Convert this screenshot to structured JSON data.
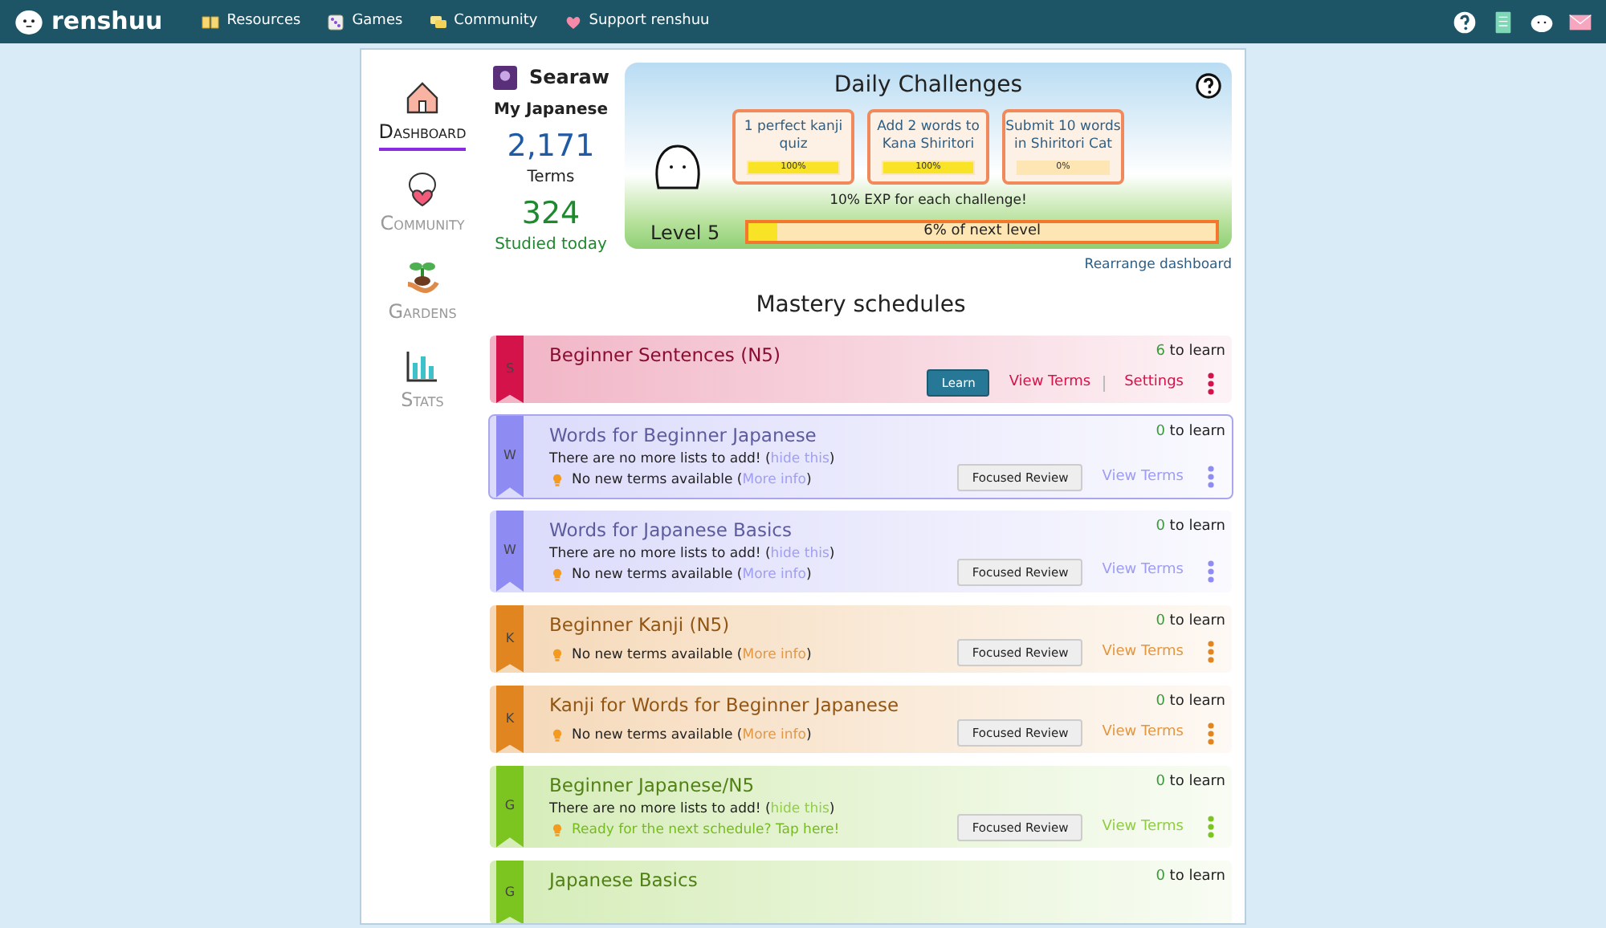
{
  "navbar": {
    "logo": "renshuu",
    "items": [
      {
        "label": "Resources"
      },
      {
        "label": "Games"
      },
      {
        "label": "Community"
      },
      {
        "label": "Support renshuu"
      }
    ]
  },
  "sidebar": {
    "items": [
      {
        "label": "Dashboard",
        "selected": true
      },
      {
        "label": "Community",
        "selected": false
      },
      {
        "label": "Gardens",
        "selected": false
      },
      {
        "label": "Stats",
        "selected": false
      }
    ]
  },
  "profile": {
    "username": "Searaw",
    "subtitle": "My Japanese",
    "terms_count": "2,171",
    "terms_label": "Terms",
    "studied_count": "324",
    "studied_label": "Studied today"
  },
  "daily_challenges": {
    "title": "Daily Challenges",
    "challenges": [
      {
        "text": "1 perfect kanji quiz",
        "level": 1,
        "reading": "100%"
      },
      {
        "text": "Add 2 words to Kana Shiritori",
        "level": 1,
        "reading": "100%"
      },
      {
        "text": "Submit 10 words in Shiritori Cat",
        "level": 0,
        "reading": "0%"
      }
    ],
    "bonus_note": "10% EXP for each challenge!",
    "level_label": "Level 5",
    "level": 0.06,
    "level_reading": "6% of next level"
  },
  "rearrange_link": "Rearrange dashboard",
  "section_title": "Mastery schedules",
  "schedules": [
    {
      "letter": "S",
      "title": "Beginner Sentences (N5)",
      "color": "#d3134a",
      "highlighted": false,
      "count": "6",
      "count_label": "to learn",
      "button": {
        "kind": "learn",
        "label": "Learn"
      },
      "links": [
        "View Terms",
        "Settings"
      ]
    },
    {
      "letter": "W",
      "title": "Words for Beginner Japanese",
      "color": "#8e8cf2",
      "highlighted": true,
      "count": "0",
      "count_label": "to learn",
      "button": {
        "kind": "review",
        "label": "Focused Review"
      },
      "links": [
        "View Terms"
      ],
      "notes": [
        {
          "kind": "lists",
          "before": "There are no more lists to add! (",
          "link": "hide this",
          "after": ")"
        },
        {
          "kind": "tip",
          "before": "No new terms available (",
          "link": "More info",
          "after": ")"
        }
      ]
    },
    {
      "letter": "W",
      "title": "Words for Japanese Basics",
      "color": "#8e8cf2",
      "highlighted": false,
      "count": "0",
      "count_label": "to learn",
      "button": {
        "kind": "review",
        "label": "Focused Review"
      },
      "links": [
        "View Terms"
      ],
      "notes": [
        {
          "kind": "lists",
          "before": "There are no more lists to add! (",
          "link": "hide this",
          "after": ")"
        },
        {
          "kind": "tip",
          "before": "No new terms available (",
          "link": "More info",
          "after": ")"
        }
      ]
    },
    {
      "letter": "K",
      "title": "Beginner Kanji (N5)",
      "color": "#e0851f",
      "highlighted": false,
      "count": "0",
      "count_label": "to learn",
      "button": {
        "kind": "review",
        "label": "Focused Review"
      },
      "links": [
        "View Terms"
      ],
      "notes": [
        {
          "kind": "tip",
          "before": "No new terms available (",
          "link": "More info",
          "after": ")"
        }
      ]
    },
    {
      "letter": "K",
      "title": "Kanji for Words for Beginner Japanese",
      "color": "#e0851f",
      "highlighted": false,
      "count": "0",
      "count_label": "to learn",
      "button": {
        "kind": "review",
        "label": "Focused Review"
      },
      "links": [
        "View Terms"
      ],
      "notes": [
        {
          "kind": "tip",
          "before": "No new terms available (",
          "link": "More info",
          "after": ")"
        }
      ]
    },
    {
      "letter": "G",
      "title": "Beginner Japanese/N5",
      "color": "#7cc520",
      "highlighted": false,
      "count": "0",
      "count_label": "to learn",
      "button": {
        "kind": "review",
        "label": "Focused Review"
      },
      "links": [
        "View Terms"
      ],
      "notes": [
        {
          "kind": "lists",
          "before": "There are no more lists to add! (",
          "link": "hide this",
          "after": ")"
        },
        {
          "kind": "tip-link",
          "link": "Ready for the next schedule? Tap here!"
        }
      ]
    },
    {
      "letter": "G",
      "title": "Japanese Basics",
      "color": "#7cc520",
      "highlighted": false,
      "count": "0",
      "count_label": "to learn"
    }
  ]
}
